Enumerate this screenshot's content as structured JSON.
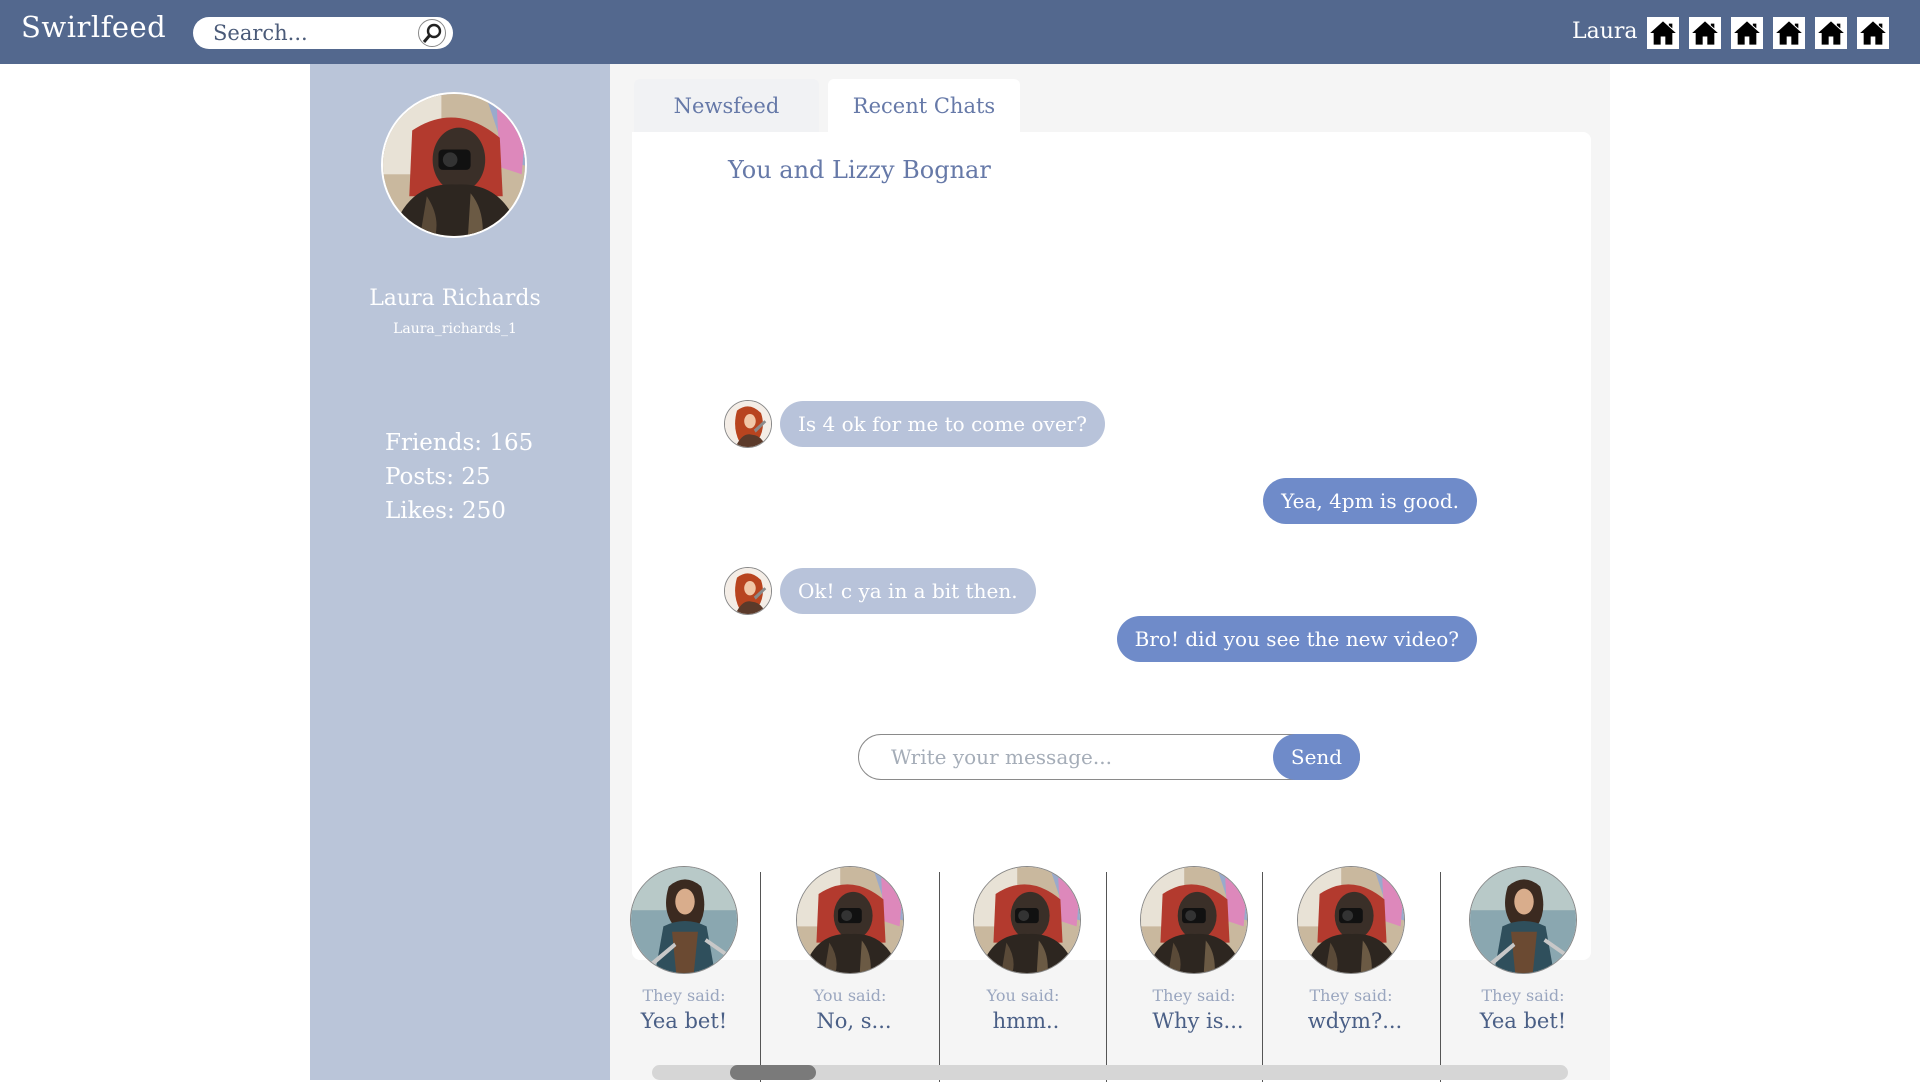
{
  "header": {
    "brand": "Swirlfeed",
    "search_placeholder": "Search...",
    "user_name": "Laura",
    "home_icons": [
      "home-icon",
      "home-icon",
      "home-icon",
      "home-icon",
      "home-icon",
      "home-icon"
    ]
  },
  "sidebar": {
    "name": "Laura Richards",
    "handle": "Laura_richards_1",
    "friends": "Friends: 165",
    "posts": "Posts: 25",
    "likes": "Likes: 250"
  },
  "tabs": {
    "newsfeed": "Newsfeed",
    "recent_chats": "Recent Chats"
  },
  "chat": {
    "title": "You and Lizzy Bognar",
    "messages": [
      {
        "from": "them",
        "text": "Is 4 ok for me  to come over?"
      },
      {
        "from": "me",
        "text": "Yea, 4pm is good."
      },
      {
        "from": "them",
        "text": "Ok! c ya in a bit then."
      },
      {
        "from": "me",
        "text": "Bro! did you see the new video?"
      }
    ],
    "compose_placeholder": "Write your message...",
    "send_label": "Send"
  },
  "recent": [
    {
      "said": "They said:",
      "text": "Yea bet!"
    },
    {
      "said": "You said:",
      "text": "No, s..."
    },
    {
      "said": "You said:",
      "text": "hmm.."
    },
    {
      "said": "They said:",
      "text": "Why is..."
    },
    {
      "said": "They said:",
      "text": "wdym?..."
    },
    {
      "said": "They said:",
      "text": "Yea bet!"
    }
  ],
  "colors": {
    "topbar": "#53688e",
    "sidebar": "#bac5d9",
    "bubble_me": "#6f8bc9",
    "bubble_them": "#b8c3da",
    "accent_text": "#6679a8"
  }
}
